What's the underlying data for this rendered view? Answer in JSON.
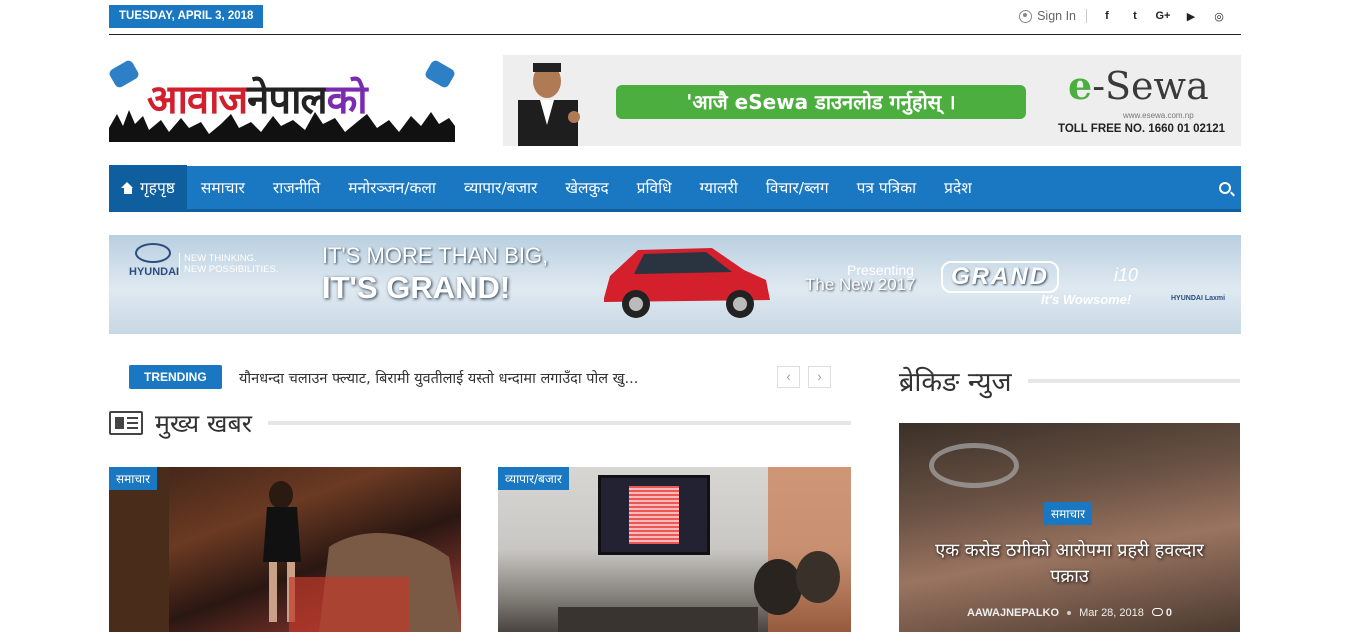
{
  "topbar": {
    "date": "TUESDAY, APRIL 3, 2018",
    "signin": "Sign In",
    "social": [
      {
        "icon": "facebook-icon",
        "glyph": "f"
      },
      {
        "icon": "twitter-icon",
        "glyph": "t"
      },
      {
        "icon": "google-plus-icon",
        "glyph": "G+"
      },
      {
        "icon": "youtube-icon",
        "glyph": "▶"
      },
      {
        "icon": "instagram-icon",
        "glyph": "◎"
      }
    ]
  },
  "logo": {
    "part1": "आवाज",
    "part2": "नेपाल",
    "part3": "को"
  },
  "esewa_ad": {
    "cta": "'आजै eSewa डाउनलोड गर्नुहोस् ।",
    "brand_e": "e",
    "brand_rest": "-Sewa",
    "url": "www.esewa.com.np",
    "toll": "TOLL FREE NO. 1660 01 02121"
  },
  "nav": {
    "home": "गृहपृष्ठ",
    "items": [
      "समाचार",
      "राजनीति",
      "मनोरञ्जन/कला",
      "व्यापार/बजार",
      "खेलकुद",
      "प्रविधि",
      "ग्यालरी",
      "विचार/ब्लग",
      "पत्र पत्रिका",
      "प्रदेश"
    ]
  },
  "hyundai_ad": {
    "brand": "HYUNDAI",
    "tagline1": "NEW THINKING.",
    "tagline2": "NEW POSSIBILITIES.",
    "line1": "IT'S MORE THAN BIG,",
    "line2": "IT'S GRAND!",
    "presenting": "Presenting",
    "new2017": "The New 2017",
    "model": "GRAND",
    "model_suffix": "i10",
    "slogan": "It's Wowsome!",
    "dealer": "HYUNDAI  Laxmi"
  },
  "trending": {
    "label": "TRENDING",
    "text": "यौनधन्दा चलाउन फ्ल्याट, बिरामी युवतीलाई यस्तो धन्दामा लगाउँदा पोल खु...",
    "prev": "‹",
    "next": "›"
  },
  "main_section": {
    "title": "मुख्य खबर"
  },
  "breaking_section": {
    "title": "ब्रेकिङ न्युज"
  },
  "cards": [
    {
      "category": "समाचार"
    },
    {
      "category": "व्यापार/बजार"
    }
  ],
  "breaking_card": {
    "category": "समाचार",
    "headline": "एक करोड ठगीको आरोपमा प्रहरी हवल्दार पक्राउ",
    "author": "AAWAJNEPALKO",
    "date": "Mar 28, 2018",
    "comments": "0"
  },
  "colors": {
    "accent": "#1a78c2",
    "accent_dark": "#0f5e9e",
    "esewa_green": "#4cae3f"
  }
}
